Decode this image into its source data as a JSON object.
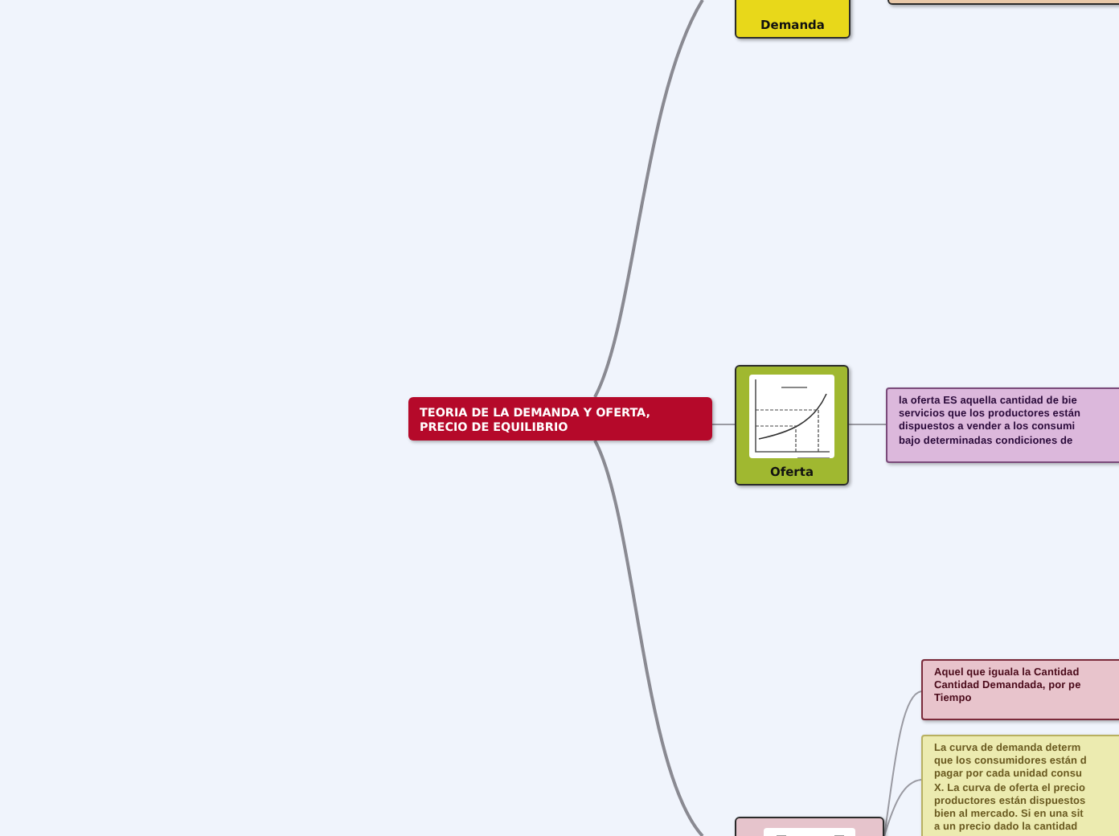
{
  "central_topic": "TEORIA DE LA DEMANDA Y OFERTA, PRECIO DE EQUILIBRIO",
  "demanda": {
    "label": "Demanda"
  },
  "oferta": {
    "label": "Oferta",
    "note_lines": [
      "la oferta ES aquella cantidad de bie",
      "servicios que los productores están",
      "dispuestos a vender a los consumi",
      "bajo determinadas condiciones de"
    ]
  },
  "equilibrio": {
    "notes": [
      {
        "kind": "definition",
        "lines": [
          "Aquel que iguala la Cantidad",
          "Cantidad Demandada, por pe",
          "Tiempo"
        ]
      },
      {
        "kind": "explanation",
        "lines": [
          "La curva de demanda determ",
          "que los consumidores están d",
          "pagar por cada unidad consu",
          "X. La curva de oferta el precio",
          "productores están dispuestos",
          "bien al mercado. Si en una sit",
          "a un precio dado la cantidad"
        ]
      }
    ]
  }
}
